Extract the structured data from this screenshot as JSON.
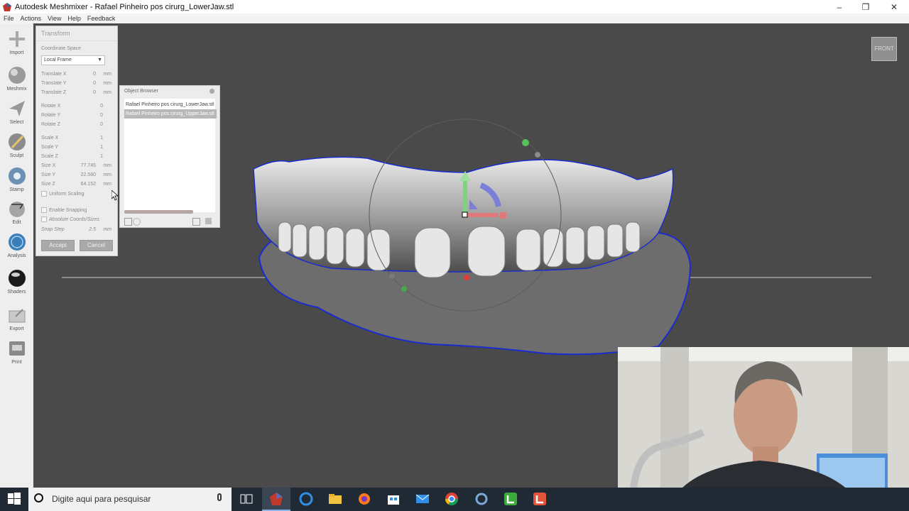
{
  "window": {
    "title": "Autodesk Meshmixer - Rafael Pinheiro pos cirurg_LowerJaw.stl"
  },
  "menu": {
    "file": "File",
    "actions": "Actions",
    "view": "View",
    "help": "Help",
    "feedback": "Feedback"
  },
  "toolbar": {
    "import": "Import",
    "meshmix": "Meshmix",
    "select": "Select",
    "sculpt": "Sculpt",
    "stamp": "Stamp",
    "edit": "Edit",
    "analysis": "Analysis",
    "shaders": "Shaders",
    "export": "Export",
    "print": "Print"
  },
  "transform": {
    "title": "Transform",
    "coordinate_space_label": "Coordinate Space",
    "coordinate_space_value": "Local Frame",
    "translate_x_label": "Translate X",
    "translate_x": "0",
    "translate_x_unit": "mm",
    "translate_y_label": "Translate Y",
    "translate_y": "0",
    "translate_y_unit": "mm",
    "translate_z_label": "Translate Z",
    "translate_z": "0",
    "translate_z_unit": "mm",
    "rotate_x_label": "Rotate X",
    "rotate_x": "0",
    "rotate_y_label": "Rotate Y",
    "rotate_y": "0",
    "rotate_z_label": "Rotate Z",
    "rotate_z": "0",
    "scale_x_label": "Scale X",
    "scale_x": "1",
    "scale_y_label": "Scale Y",
    "scale_y": "1",
    "scale_z_label": "Scale Z",
    "scale_z": "1",
    "size_x_label": "Size X",
    "size_x": "77.745",
    "size_x_unit": "mm",
    "size_y_label": "Size Y",
    "size_y": "22.580",
    "size_y_unit": "mm",
    "size_z_label": "Size Z",
    "size_z": "64.152",
    "size_z_unit": "mm",
    "uniform_scaling": "Uniform Scaling",
    "enable_snapping": "Enable Snapping",
    "absolute_coords": "Absolute Coords/Sizes",
    "snap_step_label": "Snap Step",
    "snap_step": "2.5",
    "snap_step_unit": "mm",
    "accept": "Accept",
    "cancel": "Cancel"
  },
  "object_browser": {
    "title": "Object Browser",
    "items": [
      "Rafael Pinheiro pos cirurg_LowerJaw.stl",
      "Rafael Pinheiro pos cirurg_UpperJaw.stl"
    ]
  },
  "viewcube": {
    "label": "FRONT"
  },
  "taskbar": {
    "search_placeholder": "Digite aqui para pesquisar"
  },
  "colors": {
    "viewport_bg": "#4a4a4a",
    "outline": "#1a2bd0",
    "gizmo_green": "#7fd27f",
    "gizmo_red": "#e07a7a",
    "gizmo_blue": "#7a80d8",
    "taskbar_bg": "#1f2a35"
  },
  "icons": {
    "window": [
      "meshmixer-app-icon",
      "minimize-icon",
      "restore-icon",
      "close-icon"
    ],
    "taskbar": [
      "windows-start-icon",
      "cortana-icon",
      "microphone-icon",
      "task-view-icon",
      "meshmixer-icon",
      "edge-icon",
      "file-explorer-icon",
      "firefox-icon",
      "store-icon",
      "mail-icon",
      "chrome-icon",
      "app-ring-icon",
      "camtasia-green-icon",
      "camtasia-red-icon"
    ]
  }
}
